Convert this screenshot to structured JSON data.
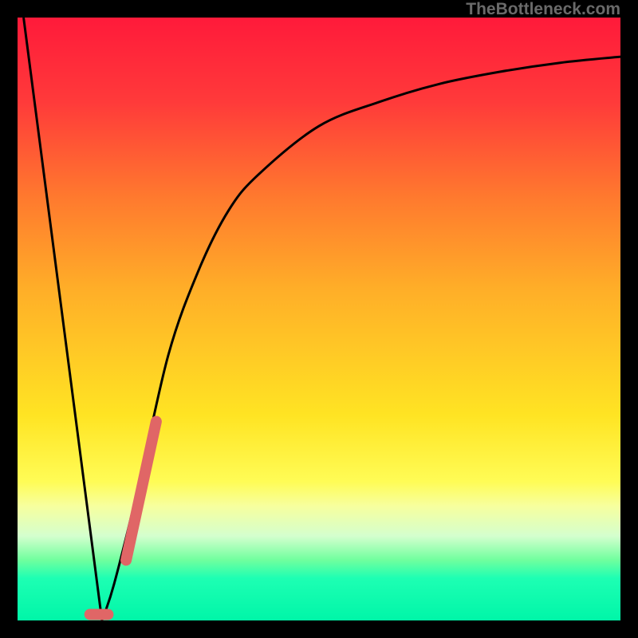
{
  "watermark": "TheBottleneck.com",
  "chart_data": {
    "type": "line",
    "title": "",
    "xlabel": "",
    "ylabel": "",
    "xlim": [
      0,
      100
    ],
    "ylim": [
      0,
      100
    ],
    "grid": false,
    "series": [
      {
        "name": "bottleneck-curve",
        "x": [
          1,
          5,
          10,
          12,
          14,
          16,
          20,
          25,
          30,
          35,
          40,
          50,
          60,
          70,
          80,
          90,
          100
        ],
        "y": [
          100,
          60,
          20,
          4,
          0,
          6,
          22,
          44,
          58,
          68,
          74,
          82,
          86,
          89,
          91,
          92.5,
          93.5
        ]
      }
    ],
    "annotations": [
      {
        "name": "short-tick",
        "x1": 12,
        "y1": 1,
        "x2": 15,
        "y2": 1,
        "color": "#e06666"
      },
      {
        "name": "long-tick",
        "x1": 18,
        "y1": 10,
        "x2": 23,
        "y2": 33,
        "color": "#e06666"
      }
    ]
  }
}
